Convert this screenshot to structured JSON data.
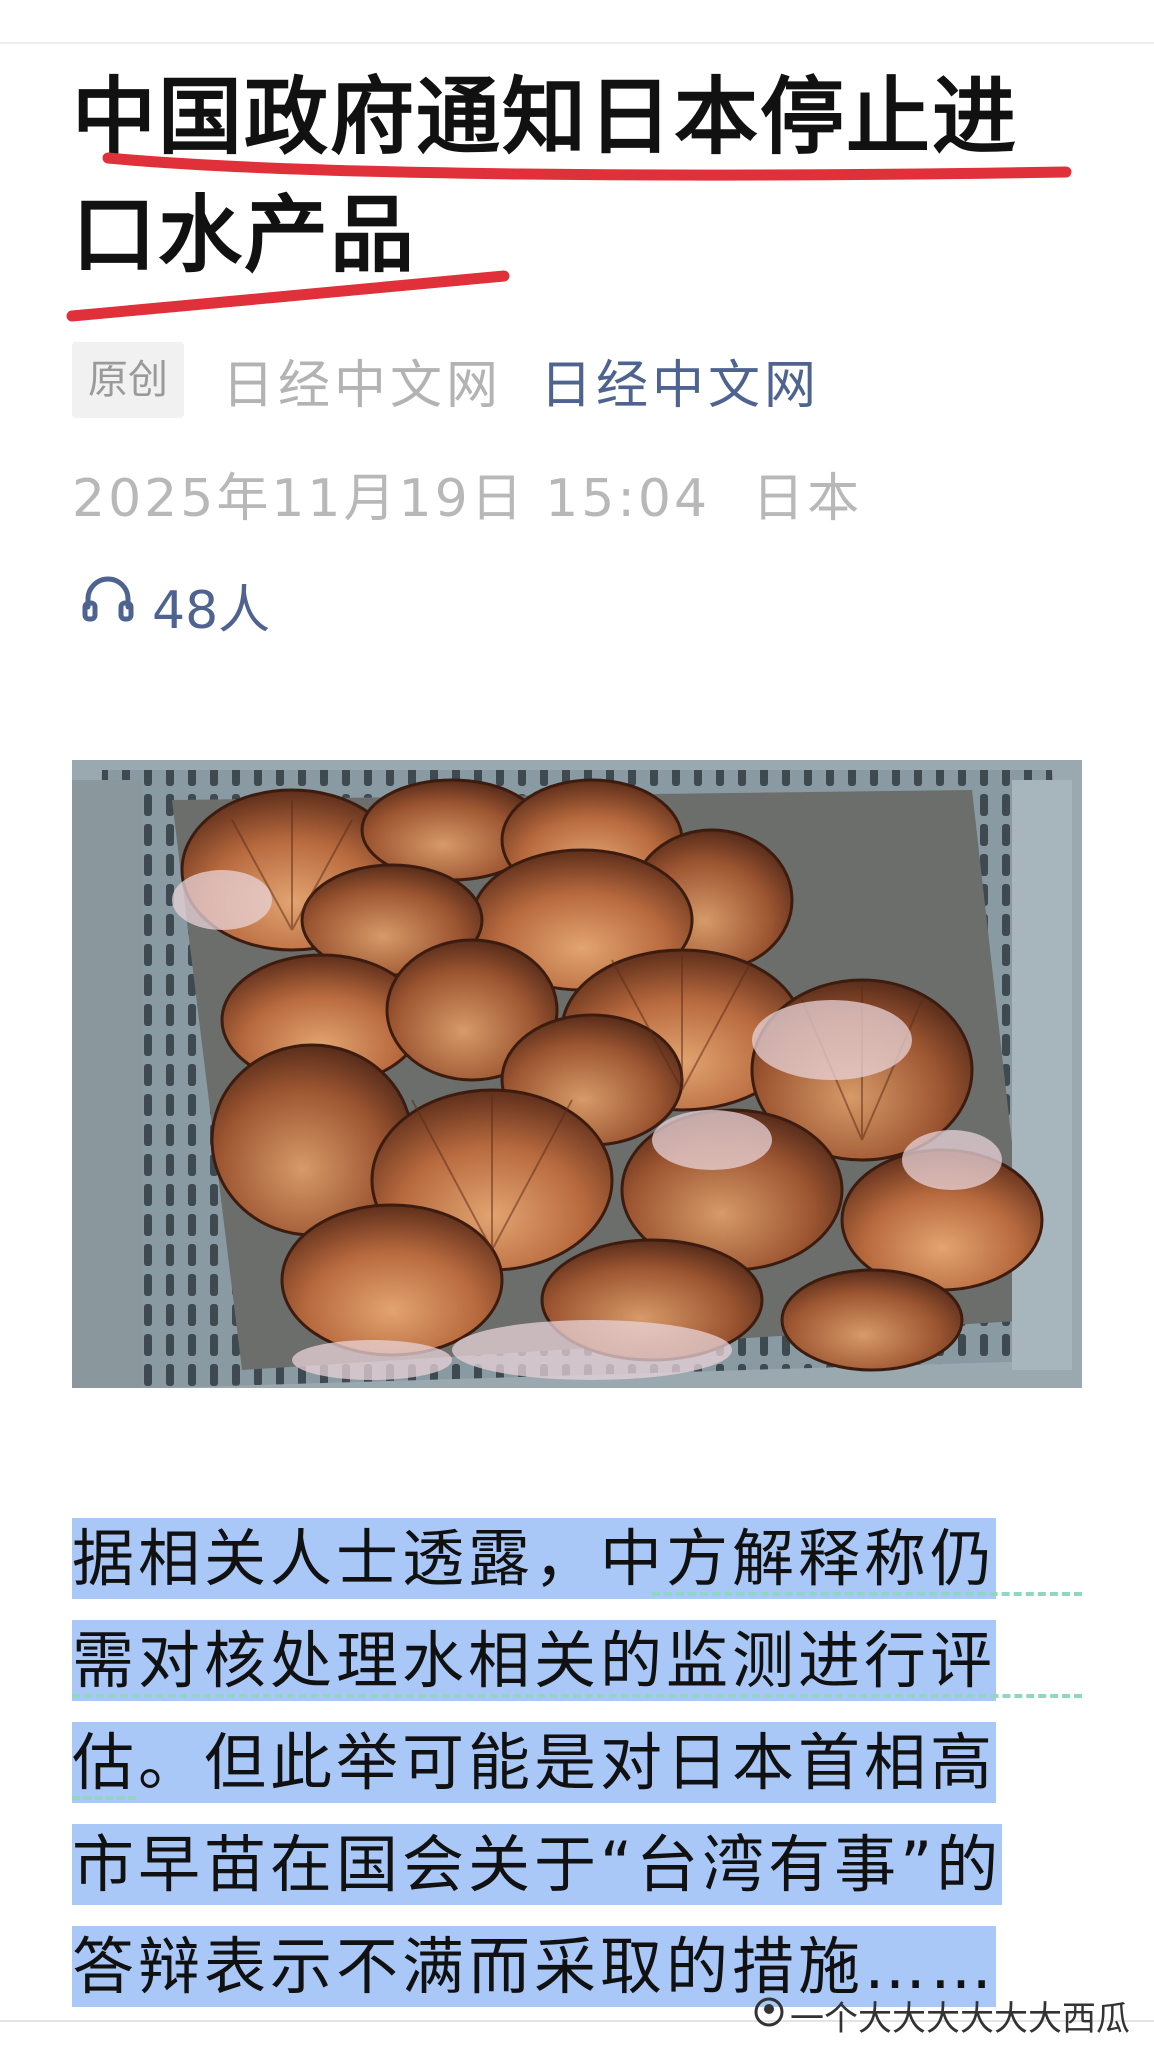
{
  "article": {
    "title": "中国政府通知日本停止进口水产品",
    "badge": "原创",
    "source_plain": "日经中文网",
    "source_link": "日经中文网",
    "date": "2025年11月19日 15:04",
    "location": "日本",
    "listeners": "48人",
    "listen_icon": "headphones-icon",
    "image_subject": "scallops-in-crate",
    "body_lines": [
      "据相关人士透露，中方解释称仍",
      "需对核处理水相关的监测进行评",
      "估。但此举可能是对日本首相高",
      "市早苗在国会关于“台湾有事”的",
      "答辩表示不满而采取的措施……"
    ]
  },
  "watermark": {
    "text": "一个大大大大大大西瓜",
    "icon": "avatar-icon"
  },
  "colors": {
    "title_underline": "#e0303a",
    "highlight": "#a9c8f8",
    "link": "#4f6391",
    "meta_grey": "#b3b3b3"
  }
}
